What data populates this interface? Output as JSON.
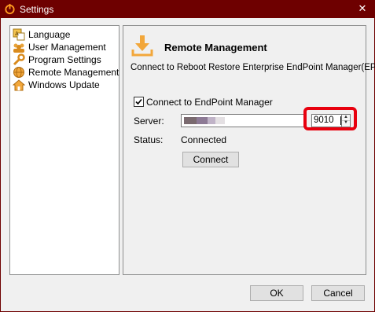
{
  "window": {
    "title": "Settings",
    "close_glyph": "✕",
    "titlebar_color": "#6e0000"
  },
  "sidebar": {
    "items": [
      {
        "label": "Language",
        "icon": "language-icon"
      },
      {
        "label": "User Management",
        "icon": "users-icon"
      },
      {
        "label": "Program Settings",
        "icon": "wrench-icon"
      },
      {
        "label": "Remote Management",
        "icon": "globe-icon"
      },
      {
        "label": "Windows Update",
        "icon": "home-icon"
      }
    ]
  },
  "panel": {
    "title": "Remote Management",
    "description": "Connect to Reboot Restore Enterprise EndPoint Manager(EPM)",
    "connect_checkbox": {
      "label": "Connect to EndPoint Manager",
      "checked": true
    },
    "server_label": "Server:",
    "server_value": "",
    "port_value": "9010",
    "status_label": "Status:",
    "status_value": "Connected",
    "connect_button": "Connect",
    "highlight_color": "#e8000e"
  },
  "footer": {
    "ok_button": "OK",
    "cancel_button": "Cancel"
  }
}
